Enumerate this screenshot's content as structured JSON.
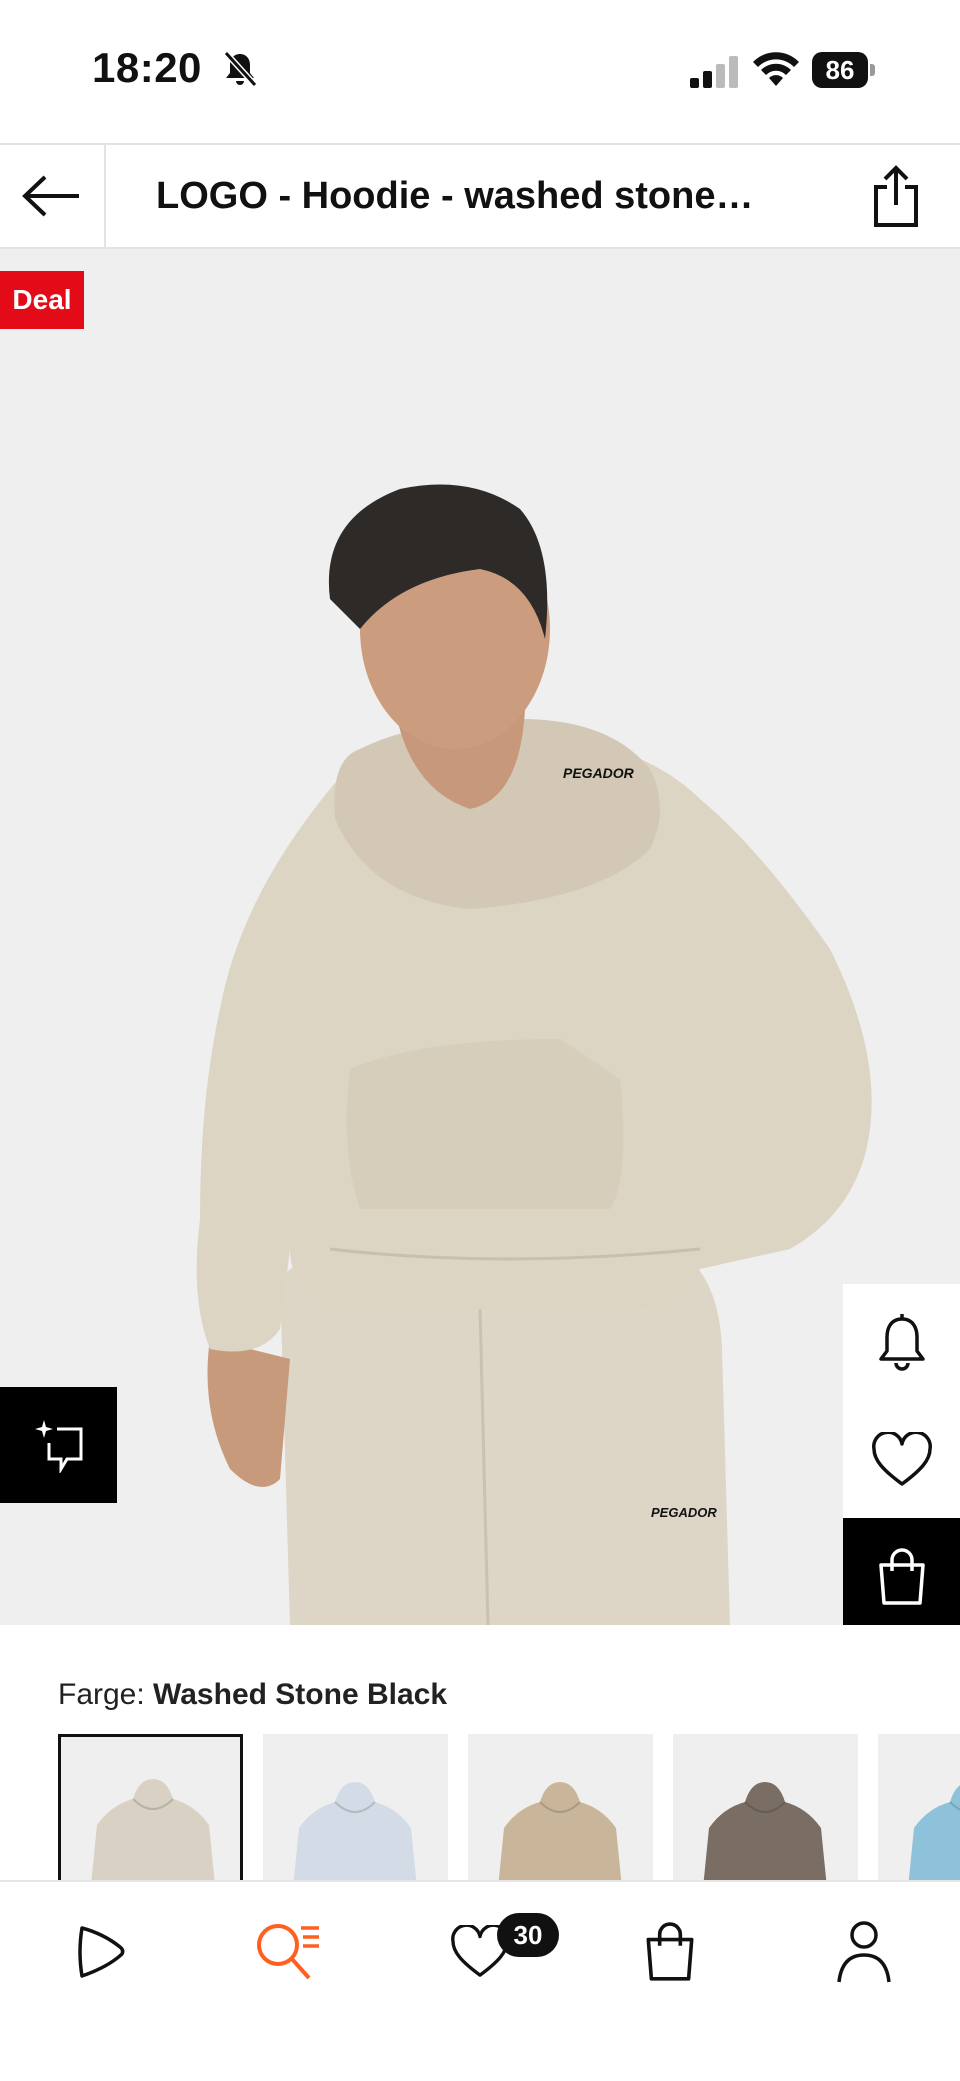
{
  "status_bar": {
    "time": "18:20",
    "battery": "86"
  },
  "header": {
    "title": "LOGO  - Hoodie - washed stone…"
  },
  "product": {
    "deal_badge": "Deal",
    "image_progress_fraction": 0.14
  },
  "color": {
    "label_prefix": "Farge: ",
    "selected_name": "Washed Stone Black",
    "swatch_colors": [
      "#d9d2c4",
      "#d3dbe6",
      "#c9b69a",
      "#7a6e64",
      "#8ec2da"
    ]
  },
  "nav": {
    "wishlist_count": "30",
    "active_color": "#ff5f1f"
  },
  "icons": {
    "back": "arrow-left-icon",
    "share": "share-icon",
    "similar": "sparkle-similar-icon",
    "notify": "bell-icon",
    "wishlist": "heart-icon",
    "cart": "bag-icon",
    "home": "play-icon",
    "search": "search-list-icon",
    "profile": "person-icon"
  }
}
